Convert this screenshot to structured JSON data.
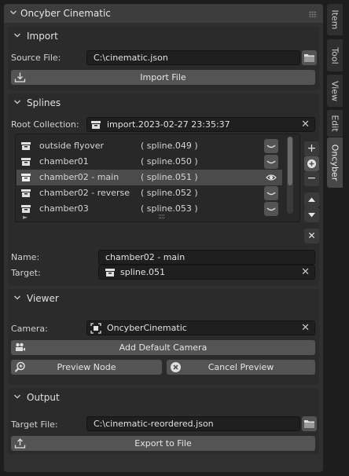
{
  "panel": {
    "title": "Oncyber Cinematic"
  },
  "import": {
    "title": "Import",
    "source_label": "Source File:",
    "source_value": "C:\\cinematic.json",
    "import_button": "Import File"
  },
  "splines": {
    "title": "Splines",
    "root_label": "Root Collection:",
    "root_value": "import.2023-02-27 23:35:37",
    "items": [
      {
        "name": "outside flyover",
        "spline": "( spline.049 )",
        "selected": false
      },
      {
        "name": "chamber01",
        "spline": "( spline.050 )",
        "selected": false
      },
      {
        "name": "chamber02 - main",
        "spline": "( spline.051 )",
        "selected": true
      },
      {
        "name": "chamber02 - reverse",
        "spline": "( spline.052 )",
        "selected": false
      },
      {
        "name": "chamber03",
        "spline": "( spline.053 )",
        "selected": false
      }
    ],
    "resize_handle": "::::",
    "name_label": "Name:",
    "name_value": "chamber02 - main",
    "target_label": "Target:",
    "target_value": "spline.051"
  },
  "viewer": {
    "title": "Viewer",
    "camera_label": "Camera:",
    "camera_value": "OncyberCinematic",
    "add_camera_button": "Add Default Camera",
    "preview_button": "Preview Node",
    "cancel_button": "Cancel Preview"
  },
  "output": {
    "title": "Output",
    "target_label": "Target File:",
    "target_value": "C:\\cinematic-reordered.json",
    "export_button": "Export to File"
  },
  "tabs": [
    "Item",
    "Tool",
    "View",
    "Edit",
    "Oncyber"
  ],
  "active_tab": "Oncyber",
  "icons": {
    "folder": "folder-icon",
    "import": "import-icon",
    "export": "export-icon",
    "collection": "collection-icon",
    "camera": "camera-icon",
    "eye": "eye-icon",
    "hidden": "eye-closed-icon",
    "zoom": "zoom-icon",
    "cancel": "cancel-icon"
  },
  "colors": {
    "panel_bg": "#303030",
    "subpanel_bg": "#2b2b2b",
    "field_bg": "#1f1f1f",
    "button_bg": "#545454",
    "selected_row": "#4b4b4b"
  }
}
